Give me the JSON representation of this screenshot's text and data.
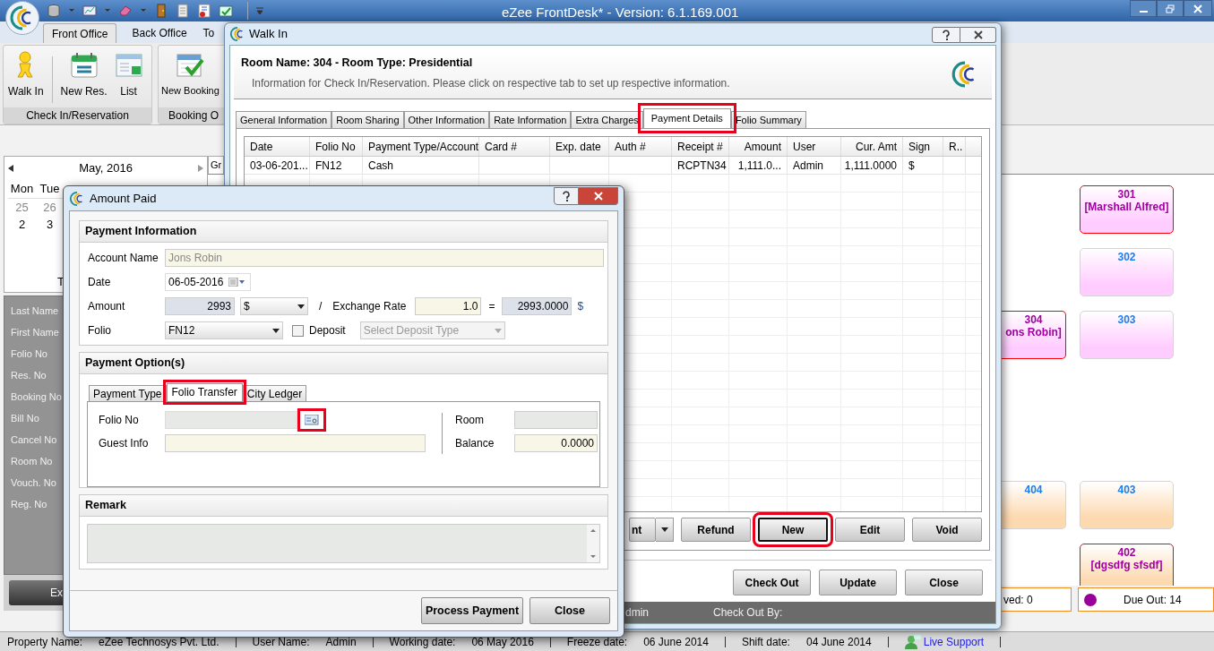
{
  "app": {
    "title": "eZee FrontDesk* - Version: 6.1.169.001"
  },
  "ribbon_tabs": [
    {
      "label": "Front Office",
      "selected": true
    },
    {
      "label": "Back Office",
      "selected": false
    },
    {
      "label": "To",
      "selected": false
    }
  ],
  "ribbon_groups": [
    {
      "label": "Check In/Reservation",
      "buttons": [
        {
          "label": "Walk In",
          "kind": "walkin"
        },
        {
          "label": "New Res.",
          "kind": "calendar"
        },
        {
          "label": "List",
          "kind": "list"
        }
      ]
    },
    {
      "label": "Booking O",
      "buttons": [
        {
          "label": "New Booking",
          "kind": "booking"
        }
      ]
    }
  ],
  "calendar": {
    "month": "May, 2016",
    "weekdays": [
      "Mon",
      "Tue"
    ],
    "days": [
      {
        "day": "25",
        "other_month": true
      },
      {
        "day": "26",
        "other_month": true
      },
      {
        "day": "2",
        "other_month": false
      },
      {
        "day": "3",
        "other_month": false
      }
    ],
    "footer": "T"
  },
  "search_labels": [
    "Last Name",
    "First Name",
    "Folio No",
    "Res. No",
    "Booking No",
    "Bill No",
    "Cancel No",
    "Room No",
    "Vouch. No",
    "Reg. No"
  ],
  "side_button": "Ex",
  "board_tab": "Gr",
  "rooms": [
    {
      "number": "301",
      "guest": "[Marshall Alfred]",
      "occupied": true,
      "color": "#ffccff"
    },
    {
      "number": "302",
      "occupied": false,
      "color": "#ffccff"
    },
    {
      "number": "304",
      "guest": "ons Robin]",
      "occupied": true,
      "color": "#ffccff"
    },
    {
      "number": "303",
      "occupied": false,
      "color": "#ffccff"
    },
    {
      "number": "404",
      "occupied": false,
      "color": "#fdd9b0"
    },
    {
      "number": "403",
      "occupied": false,
      "color": "#fdd9b0"
    },
    {
      "number": "402",
      "guest": "[dgsdfg sfsdf]",
      "occupied": true,
      "color": "#fdd9b0"
    }
  ],
  "summary": [
    {
      "label": "ved: 0"
    },
    {
      "label": "Due Out: 14",
      "color": "#990099"
    }
  ],
  "status_bar": [
    {
      "label": "Property Name:",
      "value": "eZee Technosys Pvt. Ltd."
    },
    {
      "label": "User Name:",
      "value": "Admin"
    },
    {
      "label": "Working date:",
      "value": "06 May 2016"
    },
    {
      "label": "Freeze date:",
      "value": "06 June 2014"
    },
    {
      "label": "Shift date:",
      "value": "04 June 2014"
    }
  ],
  "live_support": "Live Support",
  "walk_in": {
    "title": "Walk In",
    "heading": "Room Name: 304 - Room Type: Presidential",
    "subtitle": "Information for Check In/Reservation. Please click on respective tab to set up respective information.",
    "tabs": [
      {
        "label": "General Information",
        "selected": false,
        "highlighted": false
      },
      {
        "label": "Room Sharing",
        "selected": false,
        "highlighted": false
      },
      {
        "label": "Other Information",
        "selected": false,
        "highlighted": false
      },
      {
        "label": "Rate Information",
        "selected": false,
        "highlighted": false
      },
      {
        "label": "Extra Charges",
        "selected": false,
        "highlighted": false
      },
      {
        "label": "Payment Details",
        "selected": true,
        "highlighted": true
      },
      {
        "label": "Folio Summary",
        "selected": false,
        "highlighted": false
      }
    ],
    "columns": [
      "Date",
      "Folio No",
      "Payment Type/Account",
      "Card #",
      "Exp. date",
      "Auth #",
      "Receipt #",
      "Amount",
      "User",
      "Cur. Amt",
      "Sign",
      "R.."
    ],
    "rows": [
      [
        "03-06-201...",
        "FN12",
        "Cash",
        "",
        "",
        "",
        "RCPTN34",
        "1,111.0...",
        "Admin",
        "1,111.0000",
        "$",
        ""
      ]
    ],
    "actions": [
      {
        "label": "nt",
        "kind": "split",
        "highlighted": false
      },
      {
        "label": "Refund",
        "kind": "button",
        "highlighted": false
      },
      {
        "label": "New",
        "kind": "button",
        "highlighted": true
      },
      {
        "label": "Edit",
        "kind": "button",
        "highlighted": false
      },
      {
        "label": "Void",
        "kind": "button",
        "highlighted": false
      }
    ],
    "footer_buttons": [
      "Check Out",
      "Update",
      "Close"
    ],
    "footer": {
      "user": "dmin",
      "check_out_by": "Check Out By:"
    }
  },
  "amount_paid": {
    "title": "Amount Paid",
    "payment_information": {
      "heading": "Payment Information",
      "account_name_label": "Account Name",
      "account_name": "Jons Robin",
      "date_label": "Date",
      "date": "06-05-2016",
      "amount_label": "Amount",
      "amount": "2993",
      "currency": "$",
      "divider": "/",
      "exchange_rate_label": "Exchange Rate",
      "exchange_rate": "1.0",
      "equals": "=",
      "converted": "2993.0000",
      "converted_currency": "$",
      "folio_label": "Folio",
      "folio": "FN12",
      "deposit_label": "Deposit",
      "deposit_checked": false,
      "deposit_type_placeholder": "Select Deposit Type"
    },
    "payment_options": {
      "heading": "Payment Option(s)",
      "tabs": [
        {
          "label": "Payment Type",
          "selected": false,
          "highlighted": false
        },
        {
          "label": "Folio Transfer",
          "selected": true,
          "highlighted": true
        },
        {
          "label": "City Ledger",
          "selected": false,
          "highlighted": false
        }
      ],
      "folio_no_label": "Folio No",
      "folio_search_highlighted": true,
      "guest_info_label": "Guest Info",
      "room_label": "Room",
      "balance_label": "Balance",
      "balance": "0.0000"
    },
    "remark": {
      "heading": "Remark"
    },
    "buttons": [
      "Process Payment",
      "Close"
    ]
  }
}
